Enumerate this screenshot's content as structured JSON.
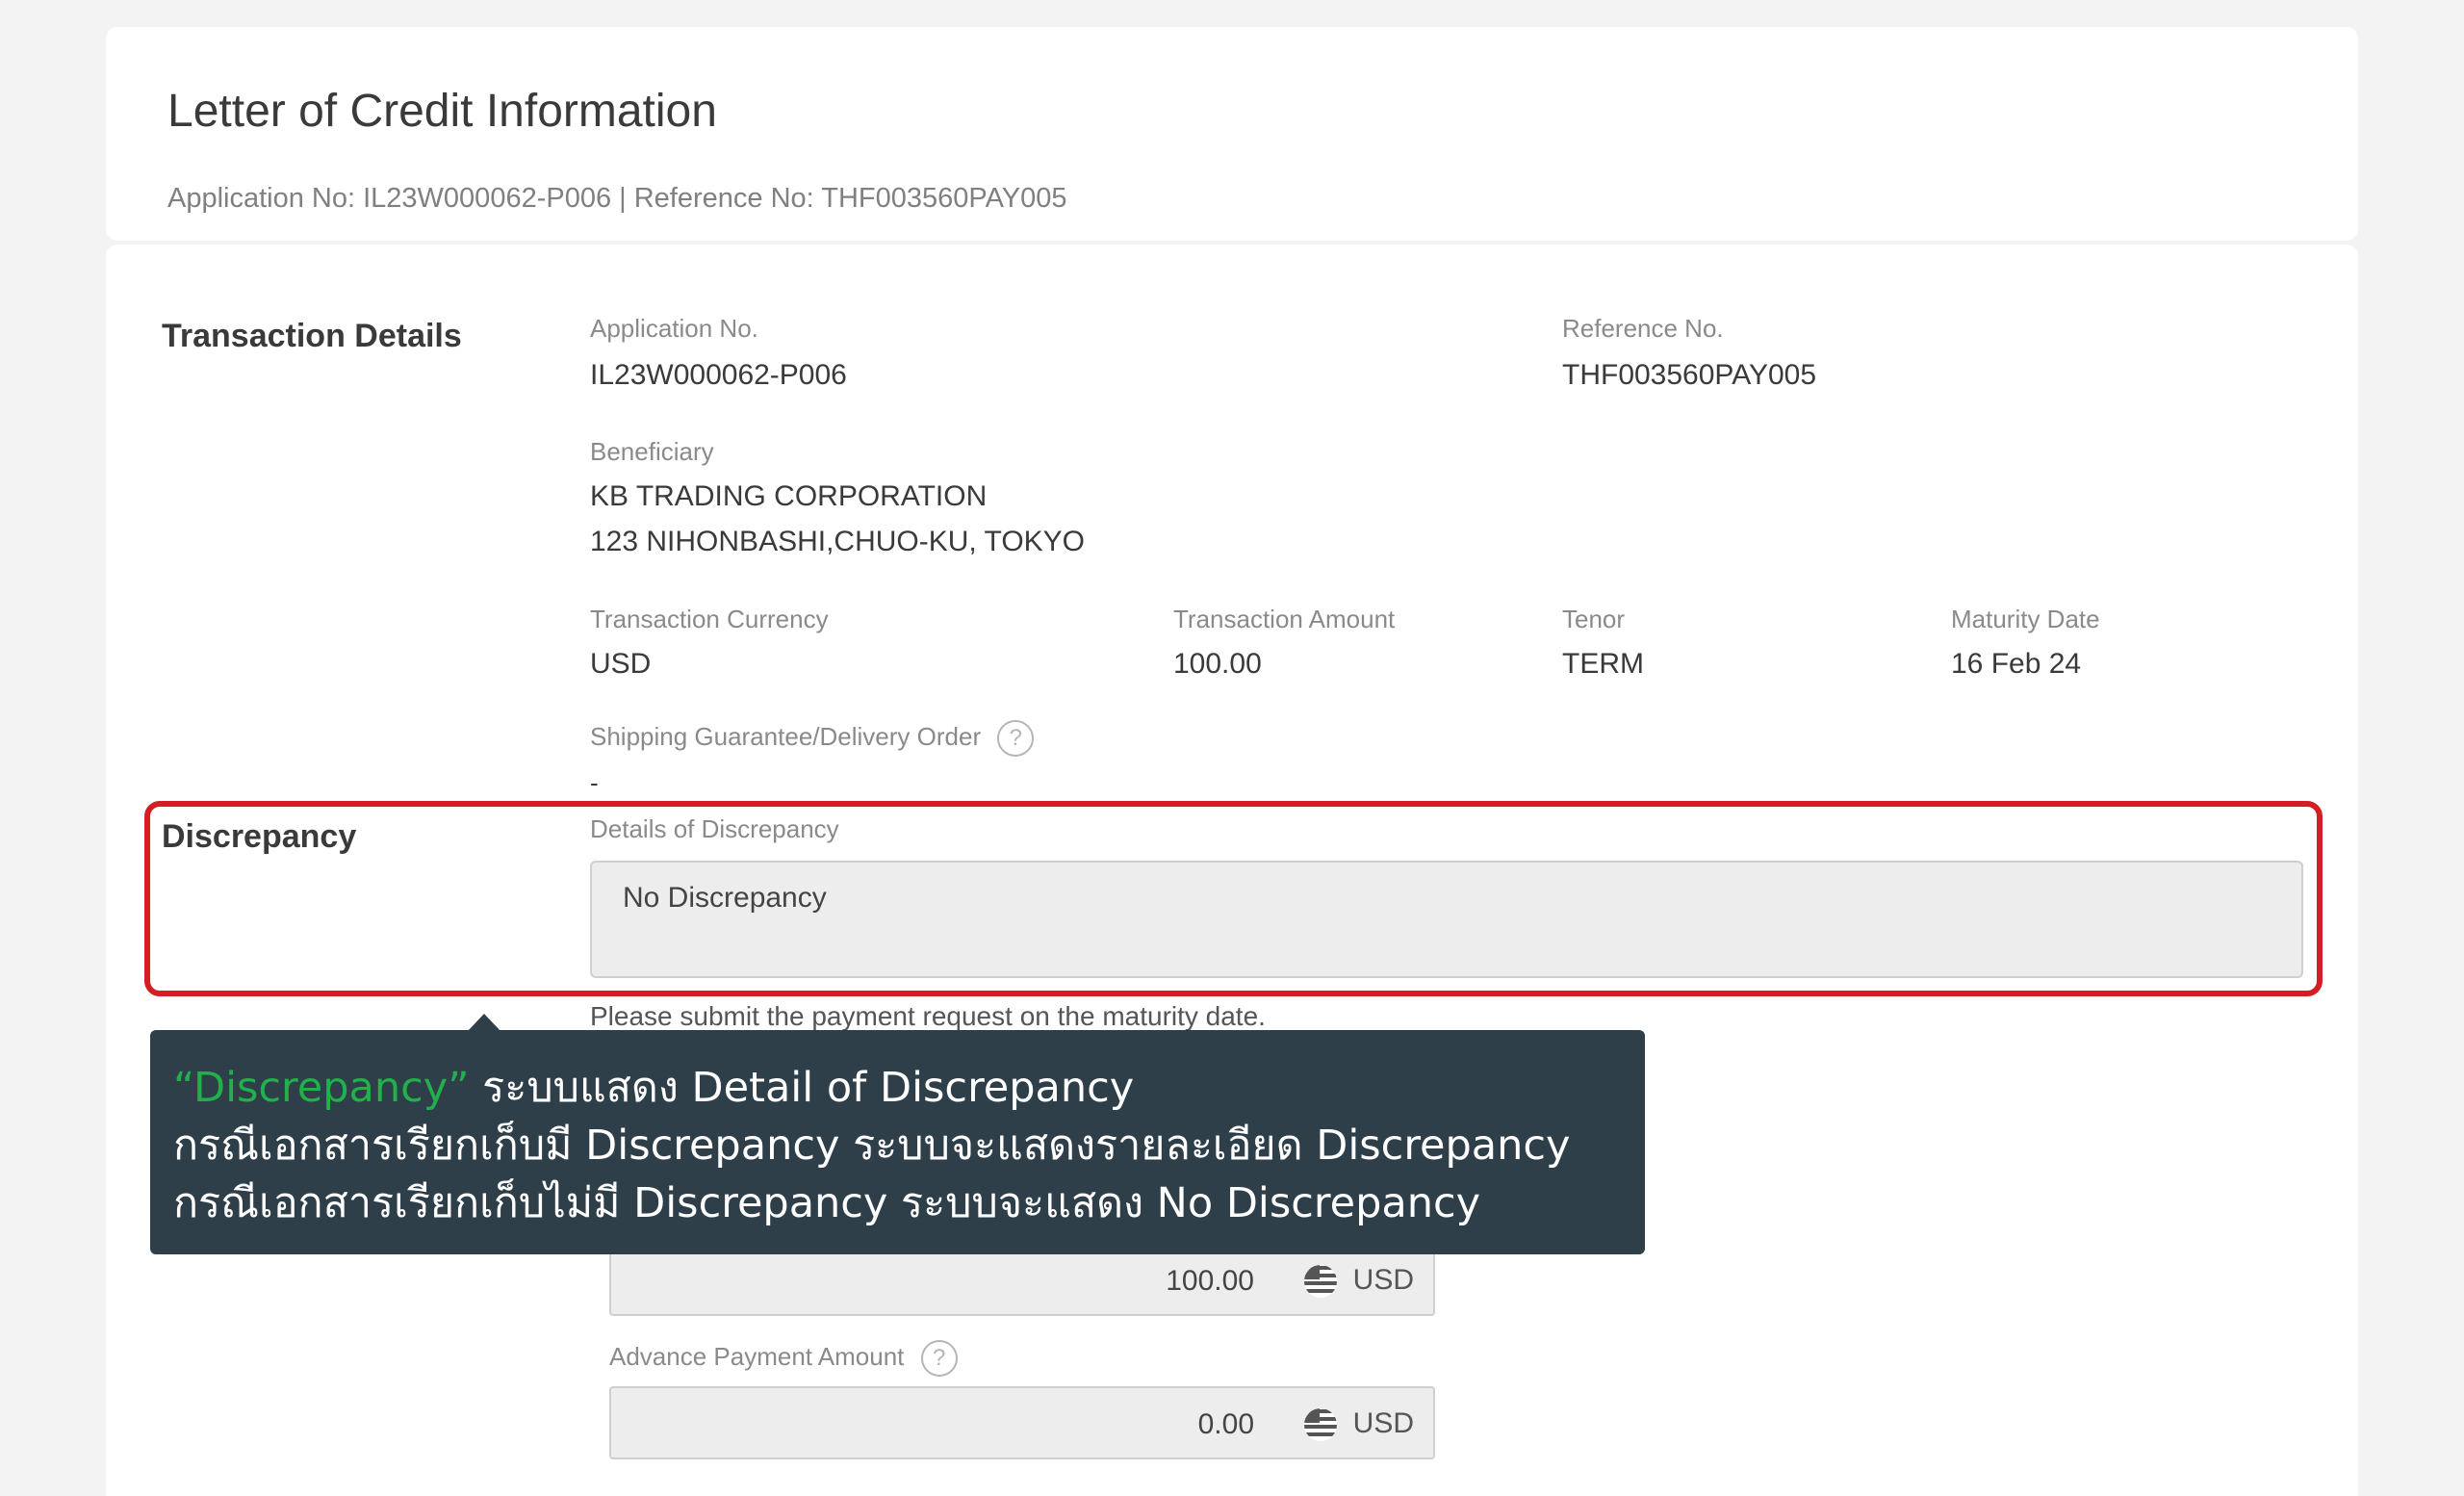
{
  "header": {
    "title": "Letter of Credit Information",
    "subtitle": "Application No: IL23W000062-P006 | Reference No: THF003560PAY005"
  },
  "transaction_details": {
    "section_title": "Transaction Details",
    "application_no_label": "Application No.",
    "application_no_value": "IL23W000062-P006",
    "reference_no_label": "Reference No.",
    "reference_no_value": "THF003560PAY005",
    "beneficiary_label": "Beneficiary",
    "beneficiary_name": "KB TRADING CORPORATION",
    "beneficiary_address": "123 NIHONBASHI,CHUO-KU, TOKYO",
    "currency_label": "Transaction Currency",
    "currency_value": "USD",
    "amount_label": "Transaction Amount",
    "amount_value": "100.00",
    "tenor_label": "Tenor",
    "tenor_value": "TERM",
    "maturity_label": "Maturity Date",
    "maturity_value": "16 Feb 24",
    "shipping_label": "Shipping Guarantee/Delivery Order",
    "shipping_value": "-",
    "help_glyph": "?"
  },
  "discrepancy": {
    "section_title": "Discrepancy",
    "details_label": "Details of Discrepancy",
    "details_value": "No Discrepancy",
    "notice": "Please submit the payment request on the maturity date."
  },
  "payment": {
    "payment_amount_value": "100.00",
    "payment_currency": "USD",
    "advance_label": "Advance Payment Amount",
    "advance_value": "0.00",
    "advance_currency": "USD"
  },
  "callout": {
    "highlight": "“Discrepancy”",
    "line1_rest": " ระบบแสดง Detail of Discrepancy",
    "line2": "กรณีเอกสารเรียกเก็บมี Discrepancy ระบบจะแสดงรายละเอียด Discrepancy",
    "line3": "กรณีเอกสารเรียกเก็บไม่มี Discrepancy ระบบจะแสดง No Discrepancy"
  },
  "colors": {
    "highlight_frame": "#d41d24",
    "callout_bg": "#2e3f49",
    "callout_accent": "#21b04b"
  },
  "icons": {
    "help": "question-circle-icon",
    "currency": "us-flag-icon"
  }
}
